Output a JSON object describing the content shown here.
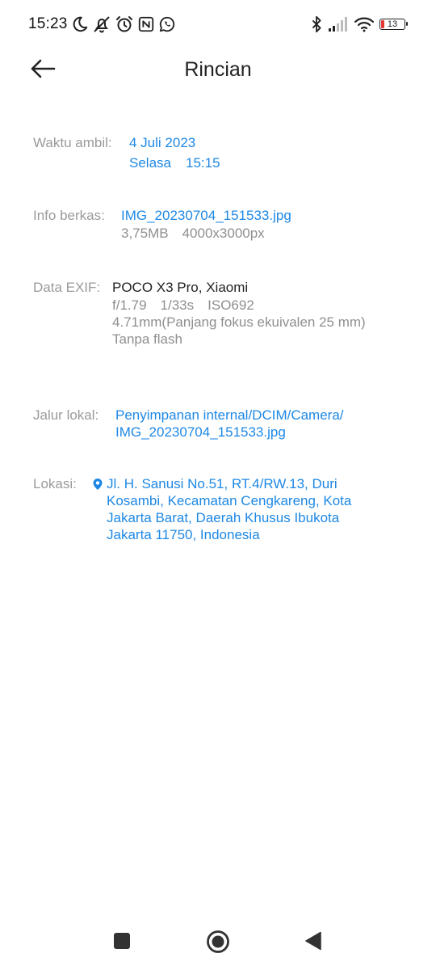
{
  "status_bar": {
    "time": "15:23",
    "battery_level": "13",
    "left_icons": [
      "moon-icon",
      "notifications-off-icon",
      "alarm-icon",
      "nfc-icon",
      "whatsapp-icon"
    ],
    "right_icons": [
      "bluetooth-icon",
      "signal-icon",
      "wifi-icon",
      "battery-icon"
    ],
    "battery_color": "#e53935"
  },
  "header": {
    "title": "Rincian",
    "back_icon": "arrow-left-icon"
  },
  "details": {
    "capture_time": {
      "label": "Waktu ambil:",
      "date": "4 Juli 2023",
      "day": "Selasa",
      "time": "15:15"
    },
    "file_info": {
      "label": "Info berkas:",
      "filename": "IMG_20230704_151533.jpg",
      "size": "3,75MB",
      "resolution": "4000x3000px"
    },
    "exif": {
      "label": "Data EXIF:",
      "device": "POCO X3 Pro, Xiaomi",
      "aperture": "f/1.79",
      "shutter": "1/33s",
      "iso": "ISO692",
      "focal": "4.71mm(Panjang fokus ekuivalen 25 mm)",
      "flash": "Tanpa flash"
    },
    "local_path": {
      "label": "Jalur lokal:",
      "line1": "Penyimpanan internal/DCIM/Camera/",
      "line2": "IMG_20230704_151533.jpg"
    },
    "location": {
      "label": "Lokasi:",
      "line1": "Jl. H. Sanusi No.51, RT.4/RW.13, Duri",
      "line2": "Kosambi, Kecamatan Cengkareng, Kota",
      "line3": "Jakarta Barat, Daerah Khusus Ibukota",
      "line4": "Jakarta 11750, Indonesia",
      "icon": "location-pin-icon"
    }
  },
  "nav_bar": {
    "buttons": [
      "recents-square-icon",
      "home-circle-icon",
      "back-triangle-icon"
    ]
  },
  "colors": {
    "accent": "#1e88e5",
    "label": "#9a9a9a",
    "text": "#222222",
    "secondary": "#8f8f8f"
  }
}
